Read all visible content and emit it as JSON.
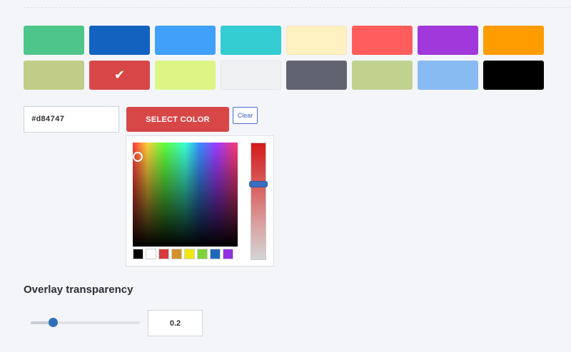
{
  "swatches": [
    {
      "color": "#4ec58b",
      "selected": false
    },
    {
      "color": "#1262c0",
      "selected": false
    },
    {
      "color": "#41a0fa",
      "selected": false
    },
    {
      "color": "#33ccd1",
      "selected": false
    },
    {
      "color": "#fff1c1",
      "selected": false
    },
    {
      "color": "#ff5d5d",
      "selected": false
    },
    {
      "color": "#a038dc",
      "selected": false
    },
    {
      "color": "#ff9c00",
      "selected": false
    },
    {
      "color": "#c1cd86",
      "selected": false
    },
    {
      "color": "#d84747",
      "selected": true
    },
    {
      "color": "#dcf585",
      "selected": false
    },
    {
      "color": "#eff0f1",
      "selected": false
    },
    {
      "color": "#616370",
      "selected": false
    },
    {
      "color": "#c1d28f",
      "selected": false
    },
    {
      "color": "#88bbf2",
      "selected": false
    },
    {
      "color": "#000000",
      "selected": false
    }
  ],
  "color_input": {
    "value": "#d84747"
  },
  "select_button": {
    "label": "SELECT COLOR"
  },
  "clear_button": {
    "label": "Clear"
  },
  "picker": {
    "presets": [
      "#000000",
      "#ffffff",
      "#d83b3b",
      "#d4922a",
      "#f2e615",
      "#7fd33a",
      "#2068b8",
      "#9133e0"
    ],
    "hue_level": 0.35
  },
  "overlay": {
    "title": "Overlay transparency",
    "value": "0.2",
    "slider_value": 0.2
  },
  "icons": {
    "check": "check-icon"
  }
}
